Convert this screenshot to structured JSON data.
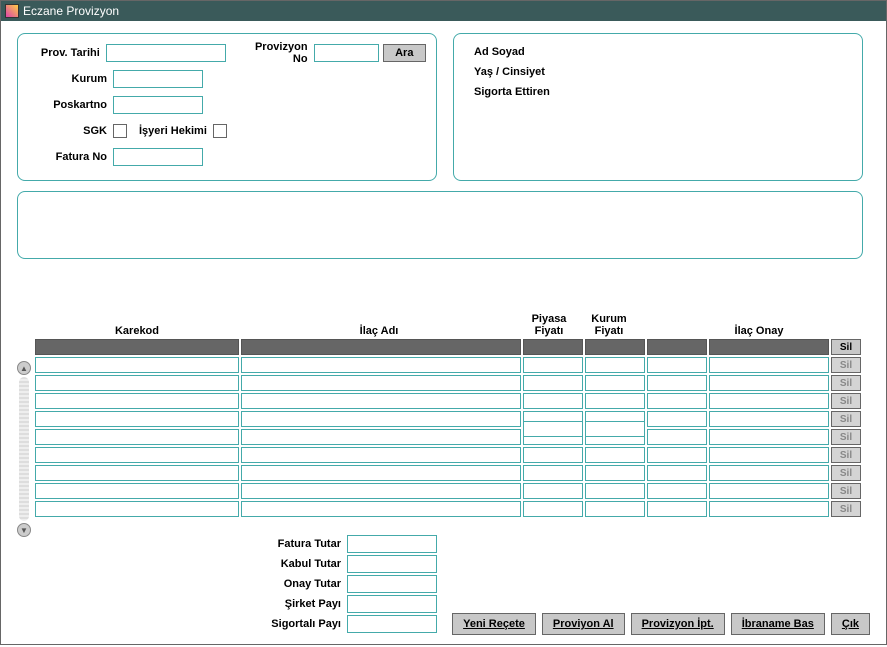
{
  "window": {
    "title": "Eczane Provizyon"
  },
  "form": {
    "prov_tarihi": {
      "label": "Prov. Tarihi",
      "value": ""
    },
    "provizyon_no": {
      "label": "Provizyon No",
      "value": ""
    },
    "ara": "Ara",
    "kurum": {
      "label": "Kurum",
      "value": ""
    },
    "poskartno": {
      "label": "Poskartno",
      "value": ""
    },
    "sgk": {
      "label": "SGK",
      "checked": false
    },
    "isyeri_hekimi": {
      "label": "İşyeri Hekimi",
      "checked": false
    },
    "fatura_no": {
      "label": "Fatura No",
      "value": ""
    }
  },
  "info": {
    "ad_soyad": "Ad Soyad",
    "yas_cinsiyet": "Yaş / Cinsiyet",
    "sigorta_ettiren": "Sigorta Ettiren"
  },
  "grid": {
    "headers": {
      "karekod": "Karekod",
      "ilac_adi": "İlaç Adı",
      "piyasa_fiyati": "Piyasa Fiyatı",
      "kurum_fiyati": "Kurum Fiyatı",
      "ilac_onay": "İlaç Onay",
      "sil": "Sil"
    }
  },
  "totals": {
    "fatura_tutar": {
      "label": "Fatura Tutar",
      "value": ""
    },
    "kabul_tutar": {
      "label": "Kabul Tutar",
      "value": ""
    },
    "onay_tutar": {
      "label": "Onay Tutar",
      "value": ""
    },
    "sirket_payi": {
      "label": "Şirket Payı",
      "value": ""
    },
    "sigortali_payi": {
      "label": "Sigortalı Payı",
      "value": ""
    }
  },
  "buttons": {
    "yeni_recete": "Yeni Reçete",
    "proviyon_al": "Proviyon Al",
    "provizyon_iptal": "Provizyon İpt.",
    "ibraname_bas": "İbraname Bas",
    "cik": "Çık"
  }
}
